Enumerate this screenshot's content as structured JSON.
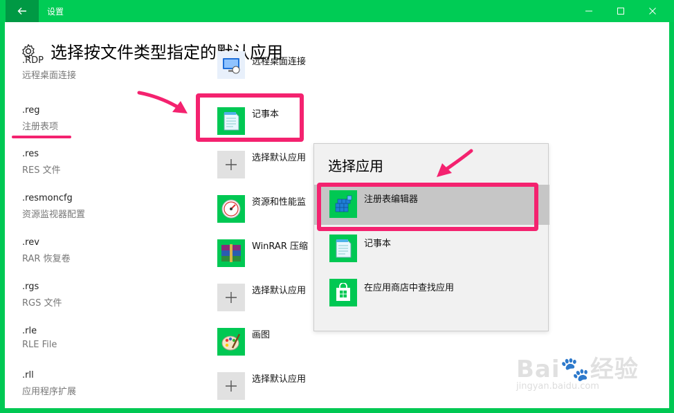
{
  "window": {
    "title": "设置",
    "accent": "#00cc55"
  },
  "page": {
    "title": "选择按文件类型指定的默认应用"
  },
  "rows": [
    {
      "ext": ".RDP",
      "desc": "远程桌面连接",
      "app": "远程桌面连接",
      "icon": "remote-desktop-icon"
    },
    {
      "ext": ".reg",
      "desc": "注册表项",
      "app": "记事本",
      "icon": "notepad-icon"
    },
    {
      "ext": ".res",
      "desc": "RES 文件",
      "app": "选择默认应用",
      "icon": "plus-icon"
    },
    {
      "ext": ".resmoncfg",
      "desc": "资源监视器配置",
      "app": "资源和性能监",
      "icon": "resource-monitor-icon"
    },
    {
      "ext": ".rev",
      "desc": "RAR 恢复卷",
      "app": "WinRAR 压缩",
      "icon": "winrar-icon"
    },
    {
      "ext": ".rgs",
      "desc": "RGS 文件",
      "app": "选择默认应用",
      "icon": "plus-icon"
    },
    {
      "ext": ".rle",
      "desc": "RLE File",
      "app": "画图",
      "icon": "paint-icon"
    },
    {
      "ext": ".rll",
      "desc": "应用程序扩展",
      "app": "选择默认应用",
      "icon": "plus-icon"
    }
  ],
  "popup": {
    "title": "选择应用",
    "items": [
      {
        "label": "注册表编辑器",
        "icon": "regedit-icon",
        "selected": true
      },
      {
        "label": "记事本",
        "icon": "notepad-icon",
        "selected": false
      },
      {
        "label": "在应用商店中查找应用",
        "icon": "store-icon",
        "selected": false
      }
    ]
  },
  "annotation_color": "#f4226f",
  "watermark": {
    "main": "Bai🐾经验",
    "sub": "jingyan.baidu.com"
  }
}
